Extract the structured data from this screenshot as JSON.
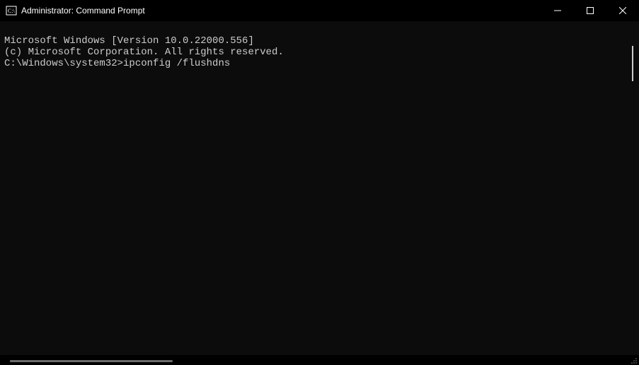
{
  "titlebar": {
    "title": "Administrator: Command Prompt"
  },
  "terminal": {
    "line1": "Microsoft Windows [Version 10.0.22000.556]",
    "line2": "(c) Microsoft Corporation. All rights reserved.",
    "blank": "",
    "prompt": "C:\\Windows\\system32>",
    "command": "ipconfig /flushdns"
  }
}
